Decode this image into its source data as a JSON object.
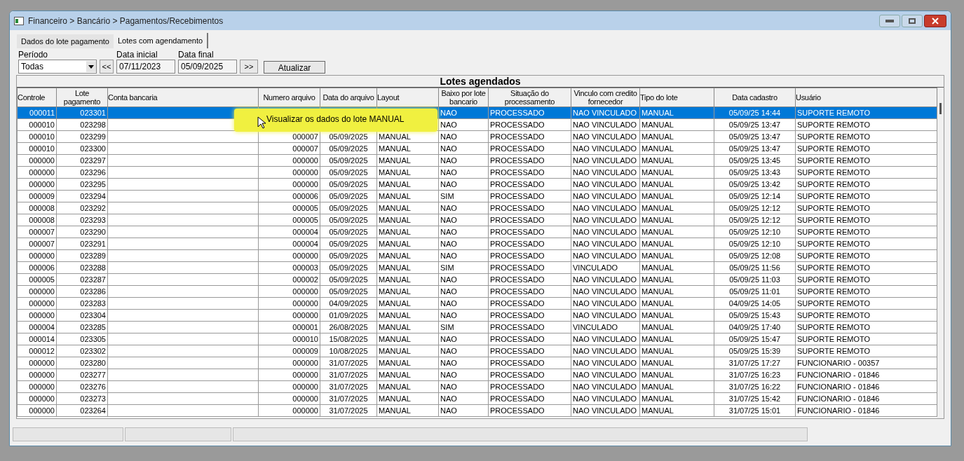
{
  "window": {
    "title": "Financeiro > Bancário > Pagamentos/Recebimentos"
  },
  "tabs": [
    {
      "label": "Dados do lote pagamento",
      "selected": false
    },
    {
      "label": "Lotes com agendamento",
      "selected": true
    }
  ],
  "filters": {
    "period_label": "Período",
    "period_value": "Todas",
    "prev_button": "<<",
    "start_label": "Data inicial",
    "start_value": "07/11/2023",
    "end_label": "Data final",
    "end_value": "05/09/2025",
    "next_button": ">>",
    "refresh_button": "Atualizar"
  },
  "table": {
    "title": "Lotes agendados",
    "columns": [
      "Controle",
      "Lote pagamento",
      "Conta bancaria",
      "Numero arquivo",
      "Data do arquivo",
      "Layout",
      "Baixo por lote bancario",
      "Situação do processamento",
      "Vinculo com credito fornecedor",
      "Tipo do lote",
      "Data cadastro",
      "Usuário"
    ],
    "rows": [
      {
        "selected": true,
        "cells": [
          "000011",
          "023301",
          null,
          null,
          null,
          null,
          "NAO",
          "PROCESSADO",
          "NAO VINCULADO",
          "MANUAL",
          "05/09/25 14:44",
          "SUPORTE REMOTO"
        ]
      },
      {
        "selected": false,
        "cells": [
          "000010",
          "023298",
          null,
          null,
          null,
          null,
          "NAO",
          "PROCESSADO",
          "NAO VINCULADO",
          "MANUAL",
          "05/09/25 13:47",
          "SUPORTE REMOTO"
        ]
      },
      {
        "selected": false,
        "cells": [
          "000010",
          "023299",
          null,
          "000007",
          "05/09/2025",
          "MANUAL",
          "NAO",
          "PROCESSADO",
          "NAO VINCULADO",
          "MANUAL",
          "05/09/25 13:47",
          "SUPORTE REMOTO"
        ]
      },
      {
        "selected": false,
        "cells": [
          "000010",
          "023300",
          null,
          "000007",
          "05/09/2025",
          "MANUAL",
          "NAO",
          "PROCESSADO",
          "NAO VINCULADO",
          "MANUAL",
          "05/09/25 13:47",
          "SUPORTE REMOTO"
        ]
      },
      {
        "selected": false,
        "cells": [
          "000000",
          "023297",
          null,
          "000000",
          "05/09/2025",
          "MANUAL",
          "NAO",
          "PROCESSADO",
          "NAO VINCULADO",
          "MANUAL",
          "05/09/25 13:45",
          "SUPORTE REMOTO"
        ]
      },
      {
        "selected": false,
        "cells": [
          "000000",
          "023296",
          null,
          "000000",
          "05/09/2025",
          "MANUAL",
          "NAO",
          "PROCESSADO",
          "NAO VINCULADO",
          "MANUAL",
          "05/09/25 13:43",
          "SUPORTE REMOTO"
        ]
      },
      {
        "selected": false,
        "cells": [
          "000000",
          "023295",
          null,
          "000000",
          "05/09/2025",
          "MANUAL",
          "NAO",
          "PROCESSADO",
          "NAO VINCULADO",
          "MANUAL",
          "05/09/25 13:42",
          "SUPORTE REMOTO"
        ]
      },
      {
        "selected": false,
        "cells": [
          "000009",
          "023294",
          null,
          "000006",
          "05/09/2025",
          "MANUAL",
          "SIM",
          "PROCESSADO",
          "NAO VINCULADO",
          "MANUAL",
          "05/09/25 12:14",
          "SUPORTE REMOTO"
        ]
      },
      {
        "selected": false,
        "cells": [
          "000008",
          "023292",
          null,
          "000005",
          "05/09/2025",
          "MANUAL",
          "NAO",
          "PROCESSADO",
          "NAO VINCULADO",
          "MANUAL",
          "05/09/25 12:12",
          "SUPORTE REMOTO"
        ]
      },
      {
        "selected": false,
        "cells": [
          "000008",
          "023293",
          null,
          "000005",
          "05/09/2025",
          "MANUAL",
          "NAO",
          "PROCESSADO",
          "NAO VINCULADO",
          "MANUAL",
          "05/09/25 12:12",
          "SUPORTE REMOTO"
        ]
      },
      {
        "selected": false,
        "cells": [
          "000007",
          "023290",
          null,
          "000004",
          "05/09/2025",
          "MANUAL",
          "NAO",
          "PROCESSADO",
          "NAO VINCULADO",
          "MANUAL",
          "05/09/25 12:10",
          "SUPORTE REMOTO"
        ]
      },
      {
        "selected": false,
        "cells": [
          "000007",
          "023291",
          null,
          "000004",
          "05/09/2025",
          "MANUAL",
          "NAO",
          "PROCESSADO",
          "NAO VINCULADO",
          "MANUAL",
          "05/09/25 12:10",
          "SUPORTE REMOTO"
        ]
      },
      {
        "selected": false,
        "cells": [
          "000000",
          "023289",
          null,
          "000000",
          "05/09/2025",
          "MANUAL",
          "NAO",
          "PROCESSADO",
          "NAO VINCULADO",
          "MANUAL",
          "05/09/25 12:08",
          "SUPORTE REMOTO"
        ]
      },
      {
        "selected": false,
        "cells": [
          "000006",
          "023288",
          null,
          "000003",
          "05/09/2025",
          "MANUAL",
          "SIM",
          "PROCESSADO",
          "VINCULADO",
          "MANUAL",
          "05/09/25 11:56",
          "SUPORTE REMOTO"
        ]
      },
      {
        "selected": false,
        "cells": [
          "000005",
          "023287",
          null,
          "000002",
          "05/09/2025",
          "MANUAL",
          "NAO",
          "PROCESSADO",
          "NAO VINCULADO",
          "MANUAL",
          "05/09/25 11:03",
          "SUPORTE REMOTO"
        ]
      },
      {
        "selected": false,
        "cells": [
          "000000",
          "023286",
          null,
          "000000",
          "05/09/2025",
          "MANUAL",
          "NAO",
          "PROCESSADO",
          "NAO VINCULADO",
          "MANUAL",
          "05/09/25 11:01",
          "SUPORTE REMOTO"
        ]
      },
      {
        "selected": false,
        "cells": [
          "000000",
          "023283",
          null,
          "000000",
          "04/09/2025",
          "MANUAL",
          "NAO",
          "PROCESSADO",
          "NAO VINCULADO",
          "MANUAL",
          "04/09/25 14:05",
          "SUPORTE REMOTO"
        ]
      },
      {
        "selected": false,
        "cells": [
          "000000",
          "023304",
          null,
          "000000",
          "01/09/2025",
          "MANUAL",
          "NAO",
          "PROCESSADO",
          "NAO VINCULADO",
          "MANUAL",
          "05/09/25 15:43",
          "SUPORTE REMOTO"
        ]
      },
      {
        "selected": false,
        "cells": [
          "000004",
          "023285",
          null,
          "000001",
          "26/08/2025",
          "MANUAL",
          "SIM",
          "PROCESSADO",
          "VINCULADO",
          "MANUAL",
          "04/09/25 17:40",
          "SUPORTE REMOTO"
        ]
      },
      {
        "selected": false,
        "cells": [
          "000014",
          "023305",
          null,
          "000010",
          "15/08/2025",
          "MANUAL",
          "NAO",
          "PROCESSADO",
          "NAO VINCULADO",
          "MANUAL",
          "05/09/25 15:47",
          "SUPORTE REMOTO"
        ]
      },
      {
        "selected": false,
        "cells": [
          "000012",
          "023302",
          null,
          "000009",
          "10/08/2025",
          "MANUAL",
          "NAO",
          "PROCESSADO",
          "NAO VINCULADO",
          "MANUAL",
          "05/09/25 15:39",
          "SUPORTE REMOTO"
        ]
      },
      {
        "selected": false,
        "cells": [
          "000000",
          "023280",
          null,
          "000000",
          "31/07/2025",
          "MANUAL",
          "NAO",
          "PROCESSADO",
          "NAO VINCULADO",
          "MANUAL",
          "31/07/25 17:27",
          "FUNCIONARIO - 00357"
        ]
      },
      {
        "selected": false,
        "cells": [
          "000000",
          "023277",
          null,
          "000000",
          "31/07/2025",
          "MANUAL",
          "NAO",
          "PROCESSADO",
          "NAO VINCULADO",
          "MANUAL",
          "31/07/25 16:23",
          "FUNCIONARIO - 01846"
        ]
      },
      {
        "selected": false,
        "cells": [
          "000000",
          "023276",
          null,
          "000000",
          "31/07/2025",
          "MANUAL",
          "NAO",
          "PROCESSADO",
          "NAO VINCULADO",
          "MANUAL",
          "31/07/25 16:22",
          "FUNCIONARIO - 01846"
        ]
      },
      {
        "selected": false,
        "cells": [
          "000000",
          "023273",
          null,
          "000000",
          "31/07/2025",
          "MANUAL",
          "NAO",
          "PROCESSADO",
          "NAO VINCULADO",
          "MANUAL",
          "31/07/25 15:42",
          "FUNCIONARIO - 01846"
        ]
      },
      {
        "selected": false,
        "cells": [
          "000000",
          "023264",
          null,
          "000000",
          "31/07/2025",
          "MANUAL",
          "NAO",
          "PROCESSADO",
          "NAO VINCULADO",
          "MANUAL",
          "31/07/25 15:01",
          "FUNCIONARIO - 01846"
        ]
      }
    ]
  },
  "tooltip": {
    "text": "Visualizar os dados do lote MANUAL"
  }
}
